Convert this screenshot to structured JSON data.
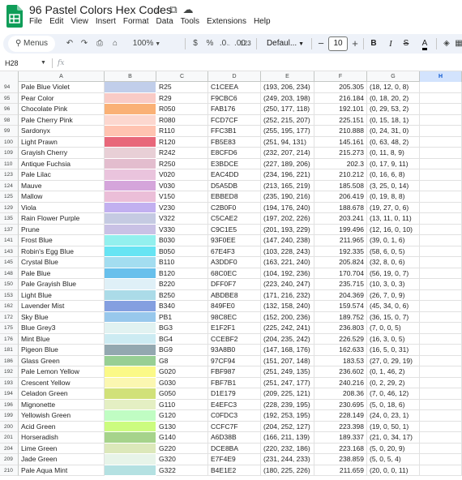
{
  "doc": {
    "title": "96 Pastel Colors Hex Codes",
    "menu": [
      "File",
      "Edit",
      "View",
      "Insert",
      "Format",
      "Data",
      "Tools",
      "Extensions",
      "Help"
    ]
  },
  "toolbar": {
    "menus_label": "Menus",
    "zoom": "100%",
    "currency": "$",
    "percent": "%",
    "dec_decrease": ".0",
    "dec_increase": ".00",
    "number_format": "123",
    "font_name": "Defaul...",
    "minus": "−",
    "font_size": "10",
    "plus": "+",
    "bold": "B",
    "italic": "I",
    "text_color": "A"
  },
  "formula_bar": {
    "name_box": "H28",
    "fx": "fx",
    "value": ""
  },
  "columns": [
    "A",
    "B",
    "C",
    "D",
    "E",
    "F",
    "G",
    "H"
  ],
  "selected_column": "H",
  "rows": [
    {
      "n": "94",
      "name": "Pale Blue Violet",
      "swatch": "#C1CEEA",
      "code": "R25",
      "hex": "C1CEEA",
      "rgb": "(193, 206, 234)",
      "f": "205.305",
      "g": "(18, 12, 0, 8)"
    },
    {
      "n": "95",
      "name": "Pear Color",
      "swatch": "#F9CBC6",
      "code": "R29",
      "hex": "F9CBC6",
      "rgb": "(249, 203, 198)",
      "f": "216.184",
      "g": "(0, 18, 20, 2)"
    },
    {
      "n": "96",
      "name": "Chocolate Pink",
      "swatch": "#FAB176",
      "code": "R050",
      "hex": "FAB176",
      "rgb": "(250, 177, 118)",
      "f": "192.101",
      "g": "(0, 29, 53, 2)"
    },
    {
      "n": "98",
      "name": "Pale Cherry Pink",
      "swatch": "#FCD7CF",
      "code": "R080",
      "hex": "FCD7CF",
      "rgb": "(252, 215, 207)",
      "f": "225.151",
      "g": "(0, 15, 18, 1)"
    },
    {
      "n": "99",
      "name": "Sardonyx",
      "swatch": "#FFC3B1",
      "code": "R110",
      "hex": "FFC3B1",
      "rgb": "(255, 195, 177)",
      "f": "210.888",
      "g": "(0, 24, 31, 0)"
    },
    {
      "n": "100",
      "name": "Light Prawn",
      "swatch": "#E8677A",
      "code": "R120",
      "hex": "FB5E83",
      "rgb": "(251, 94, 131)",
      "f": "145.161",
      "g": "(0, 63, 48, 2)"
    },
    {
      "n": "109",
      "name": "Grayish Cherry",
      "swatch": "#E8CFD6",
      "code": "R242",
      "hex": "E8CFD6",
      "rgb": "(232, 207, 214)",
      "f": "215.273",
      "g": "(0, 11, 8, 9)"
    },
    {
      "n": "110",
      "name": "Antique Fuchsia",
      "swatch": "#E3BDCE",
      "code": "R250",
      "hex": "E3BDCE",
      "rgb": "(227, 189, 206)",
      "f": "202.3",
      "g": "(0, 17, 9, 11)"
    },
    {
      "n": "123",
      "name": "Pale Lilac",
      "swatch": "#EAC4DD",
      "code": "V020",
      "hex": "EAC4DD",
      "rgb": "(234, 196, 221)",
      "f": "210.212",
      "g": "(0, 16, 6, 8)"
    },
    {
      "n": "124",
      "name": "Mauve",
      "swatch": "#D5A5DB",
      "code": "V030",
      "hex": "D5A5DB",
      "rgb": "(213, 165, 219)",
      "f": "185.508",
      "g": "(3, 25, 0, 14)"
    },
    {
      "n": "125",
      "name": "Mallow",
      "swatch": "#EBBED8",
      "code": "V150",
      "hex": "EBBED8",
      "rgb": "(235, 190, 216)",
      "f": "206.419",
      "g": "(0, 19, 8, 8)"
    },
    {
      "n": "129",
      "name": "Viola",
      "swatch": "#C2B0F0",
      "code": "V230",
      "hex": "C2B0F0",
      "rgb": "(194, 176, 240)",
      "f": "188.678",
      "g": "(19, 27, 0, 6)"
    },
    {
      "n": "135",
      "name": "Rain Flower Purple",
      "swatch": "#C5CAE2",
      "code": "V322",
      "hex": "C5CAE2",
      "rgb": "(197, 202, 226)",
      "f": "203.241",
      "g": "(13, 11, 0, 11)"
    },
    {
      "n": "137",
      "name": "Prune",
      "swatch": "#C9C1E5",
      "code": "V330",
      "hex": "C9C1E5",
      "rgb": "(201, 193, 229)",
      "f": "199.496",
      "g": "(12, 16, 0, 10)"
    },
    {
      "n": "141",
      "name": "Frost Blue",
      "swatch": "#93F0EE",
      "code": "B030",
      "hex": "93F0EE",
      "rgb": "(147, 240, 238)",
      "f": "211.965",
      "g": "(39, 0, 1, 6)"
    },
    {
      "n": "143",
      "name": "Robin's Egg Blue",
      "swatch": "#67E4F3",
      "code": "B050",
      "hex": "67E4F3",
      "rgb": "(103, 228, 243)",
      "f": "192.335",
      "g": "(58, 6, 0, 5)"
    },
    {
      "n": "145",
      "name": "Crystal Blue",
      "swatch": "#A3DDF0",
      "code": "B110",
      "hex": "A3DDF0",
      "rgb": "(163, 221, 240)",
      "f": "205.824",
      "g": "(32, 8, 0, 6)"
    },
    {
      "n": "148",
      "name": "Pale Blue",
      "swatch": "#68C0EC",
      "code": "B120",
      "hex": "68C0EC",
      "rgb": "(104, 192, 236)",
      "f": "170.704",
      "g": "(56, 19, 0, 7)"
    },
    {
      "n": "150",
      "name": "Pale Grayish Blue",
      "swatch": "#DFF0F7",
      "code": "B220",
      "hex": "DFF0F7",
      "rgb": "(223, 240, 247)",
      "f": "235.715",
      "g": "(10, 3, 0, 3)"
    },
    {
      "n": "153",
      "name": "Light Blue",
      "swatch": "#ABDBE8",
      "code": "B250",
      "hex": "ABDBE8",
      "rgb": "(171, 216, 232)",
      "f": "204.369",
      "g": "(26, 7, 0, 9)"
    },
    {
      "n": "162",
      "name": "Lavender Mist",
      "swatch": "#849FE0",
      "code": "B340",
      "hex": "849FE0",
      "rgb": "(132, 158, 240)",
      "f": "159.574",
      "g": "(45, 34, 0, 6)"
    },
    {
      "n": "172",
      "name": "Sky Blue",
      "swatch": "#98C8EC",
      "code": "PB1",
      "hex": "98C8EC",
      "rgb": "(152, 200, 236)",
      "f": "189.752",
      "g": "(36, 15, 0, 7)"
    },
    {
      "n": "175",
      "name": "Blue Grey3",
      "swatch": "#E1F2F1",
      "code": "BG3",
      "hex": "E1F2F1",
      "rgb": "(225, 242, 241)",
      "f": "236.803",
      "g": "(7, 0, 0, 5)"
    },
    {
      "n": "176",
      "name": "Mint Blue",
      "swatch": "#CCEBF2",
      "code": "BG4",
      "hex": "CCEBF2",
      "rgb": "(204, 235, 242)",
      "f": "226.529",
      "g": "(16, 3, 0, 5)"
    },
    {
      "n": "181",
      "name": "Pigeon Blue",
      "swatch": "#93A8B0",
      "code": "BG9",
      "hex": "93A8B0",
      "rgb": "(147, 168, 176)",
      "f": "162.633",
      "g": "(16, 5, 0, 31)"
    },
    {
      "n": "186",
      "name": "Glass Green",
      "swatch": "#97CF94",
      "code": "G8",
      "hex": "97CF94",
      "rgb": "(151, 207, 148)",
      "f": "183.53",
      "g": "(27, 0, 29, 19)"
    },
    {
      "n": "192",
      "name": "Pale Lemon Yellow",
      "swatch": "#FBF987",
      "code": "G020",
      "hex": "FBF987",
      "rgb": "(251, 249, 135)",
      "f": "236.602",
      "g": "(0, 1, 46, 2)"
    },
    {
      "n": "193",
      "name": "Crescent Yellow",
      "swatch": "#FBF7B1",
      "code": "G030",
      "hex": "FBF7B1",
      "rgb": "(251, 247, 177)",
      "f": "240.216",
      "g": "(0, 2, 29, 2)"
    },
    {
      "n": "194",
      "name": "Celadon Green",
      "swatch": "#D1E179",
      "code": "G050",
      "hex": "D1E179",
      "rgb": "(209, 225, 121)",
      "f": "208.36",
      "g": "(7, 0, 46, 12)"
    },
    {
      "n": "196",
      "name": "Mignonette",
      "swatch": "#E4EFC3",
      "code": "G110",
      "hex": "E4EFC3",
      "rgb": "(228, 239, 195)",
      "f": "230.695",
      "g": "(5, 0, 18, 6)"
    },
    {
      "n": "199",
      "name": "Yellowish Green",
      "swatch": "#C0FDC3",
      "code": "G120",
      "hex": "C0FDC3",
      "rgb": "(192, 253, 195)",
      "f": "228.149",
      "g": "(24, 0, 23, 1)"
    },
    {
      "n": "200",
      "name": "Acid Green",
      "swatch": "#CCFC7F",
      "code": "G130",
      "hex": "CCFC7F",
      "rgb": "(204, 252, 127)",
      "f": "223.398",
      "g": "(19, 0, 50, 1)"
    },
    {
      "n": "201",
      "name": "Horseradish",
      "swatch": "#A6D38B",
      "code": "G140",
      "hex": "A6D38B",
      "rgb": "(166, 211, 139)",
      "f": "189.337",
      "g": "(21, 0, 34, 17)"
    },
    {
      "n": "204",
      "name": "Lime Green",
      "swatch": "#DCE8BA",
      "code": "G220",
      "hex": "DCE8BA",
      "rgb": "(220, 232, 186)",
      "f": "223.168",
      "g": "(5, 0, 20, 9)"
    },
    {
      "n": "209",
      "name": "Jade Green",
      "swatch": "#E7F4E9",
      "code": "G320",
      "hex": "E7F4E9",
      "rgb": "(231, 244, 233)",
      "f": "238.859",
      "g": "(5, 0, 5, 4)"
    },
    {
      "n": "210",
      "name": "Pale Aqua Mint",
      "swatch": "#B4E1E2",
      "code": "G322",
      "hex": "B4E1E2",
      "rgb": "(180, 225, 226)",
      "f": "211.659",
      "g": "(20, 0, 0, 11)"
    }
  ]
}
